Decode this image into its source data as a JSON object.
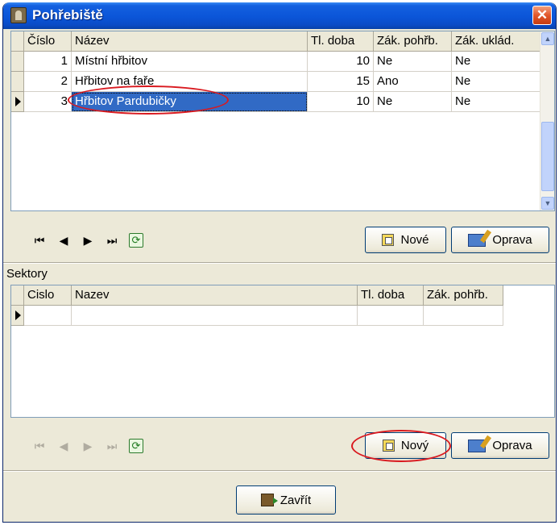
{
  "window": {
    "title": "Pohřebiště",
    "close_glyph": "✕"
  },
  "cemetery_grid": {
    "columns": [
      "Číslo",
      "Název",
      "Tl. doba",
      "Zák. pohřb.",
      "Zák. uklád."
    ],
    "rows": [
      [
        "1",
        "Místní hřbitov",
        "10",
        "Ne",
        "Ne"
      ],
      [
        "2",
        "Hřbitov na faře",
        "15",
        "Ano",
        "Ne"
      ],
      [
        "3",
        "Hřbitov Pardubičky",
        "10",
        "Ne",
        "Ne"
      ]
    ],
    "selected_row": 2
  },
  "nav1": {
    "first": "⏮",
    "prev": "◀",
    "next": "▶",
    "last": "⏭",
    "refresh": "⟳"
  },
  "buttons1": {
    "new_label": "Nové",
    "edit_label": "Oprava"
  },
  "sectors": {
    "label": "Sektory",
    "columns": [
      "Cislo",
      "Nazev",
      "Tl. doba",
      "Zák. pohřb."
    ]
  },
  "buttons2": {
    "new_label": "Nový",
    "edit_label": "Oprava"
  },
  "footer": {
    "close_label": "Zavřít"
  },
  "colors": {
    "title_blue": "#0b55d8",
    "selection": "#316ac5",
    "highlight_ellipse": "#d9191f"
  },
  "icons": [
    "cemetery-icon",
    "close-icon",
    "first-record-icon",
    "prev-record-icon",
    "next-record-icon",
    "last-record-icon",
    "refresh-icon",
    "new-icon",
    "edit-icon",
    "exit-icon"
  ]
}
